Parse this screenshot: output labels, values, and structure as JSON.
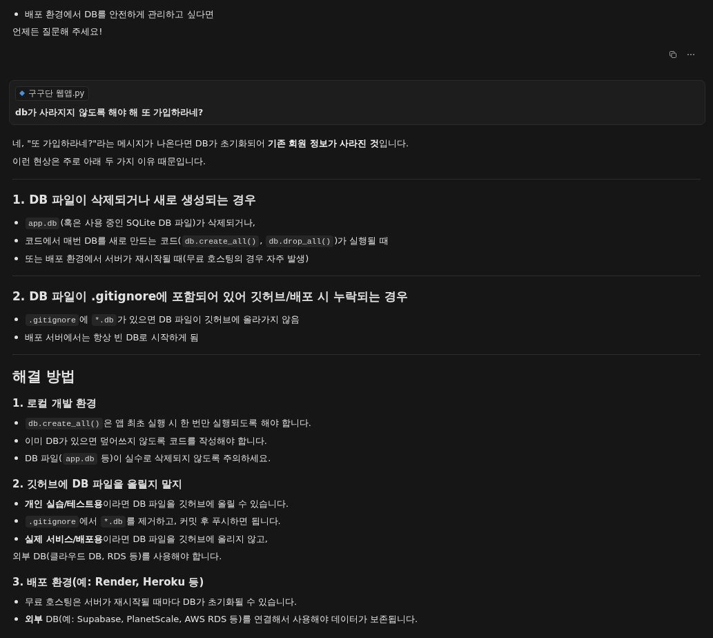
{
  "previous_answer": {
    "blocks": [
      {
        "kind": "bullet",
        "parts": [
          {
            "kind": "text",
            "text": "배포 환경에서 DB를 안전하게 관리하고 싶다면"
          }
        ]
      },
      {
        "kind": "paragraph",
        "parts": [
          {
            "kind": "text",
            "text": "언제든 질문해 주세요!"
          }
        ]
      }
    ]
  },
  "user_message": {
    "attachment": "구구단 웹앱.py",
    "text": "db가 사라지지 않도록 해야 해 또 가입하라네?"
  },
  "answer": {
    "blocks": [
      {
        "kind": "paragraph",
        "parts": [
          {
            "kind": "text",
            "text": "네, \"또 가입하라네?\"라는 메시지가 나온다면 DB가 초기화되어 **기존 회원 정보가 사라진 것**입니다."
          }
        ]
      },
      {
        "kind": "paragraph",
        "parts": [
          {
            "kind": "text",
            "text": "이런 현상은 주로 아래 두 가지 이유 때문입니다."
          }
        ]
      },
      {
        "kind": "divider"
      },
      {
        "kind": "heading3",
        "parts": [
          {
            "kind": "text",
            "text": "1. DB 파일이 삭제되거나 새로 생성되는 경우"
          }
        ]
      },
      {
        "kind": "bullet",
        "parts": [
          {
            "kind": "code",
            "text": "app.db"
          },
          {
            "kind": "text",
            "text": "(혹은 사용 중인 SQLite DB 파일)가 삭제되거나,"
          }
        ]
      },
      {
        "kind": "bullet",
        "parts": [
          {
            "kind": "text",
            "text": "코드에서 매번 DB를 새로 만드는 코드("
          },
          {
            "kind": "code",
            "text": "db.create_all()"
          },
          {
            "kind": "text",
            "text": ", "
          },
          {
            "kind": "code",
            "text": "db.drop_all()"
          },
          {
            "kind": "text",
            "text": ")가 실행될 때"
          }
        ]
      },
      {
        "kind": "bullet",
        "parts": [
          {
            "kind": "text",
            "text": "또는 배포 환경에서 서버가 재시작될 때(무료 호스팅의 경우 자주 발생)"
          }
        ]
      },
      {
        "kind": "divider"
      },
      {
        "kind": "heading3",
        "parts": [
          {
            "kind": "text",
            "text": "2. DB 파일이 .gitignore에 포함되어 있어 깃허브/배포 시 누락되는 경우"
          }
        ]
      },
      {
        "kind": "bullet",
        "parts": [
          {
            "kind": "code",
            "text": ".gitignore"
          },
          {
            "kind": "text",
            "text": "에 "
          },
          {
            "kind": "code",
            "text": "*.db"
          },
          {
            "kind": "text",
            "text": "가 있으면 DB 파일이 깃허브에 올라가지 않음"
          }
        ]
      },
      {
        "kind": "bullet",
        "parts": [
          {
            "kind": "text",
            "text": "배포 서버에서는 항상 빈 DB로 시작하게 됨"
          }
        ]
      },
      {
        "kind": "divider"
      },
      {
        "kind": "heading2",
        "parts": [
          {
            "kind": "text",
            "text": "해결 방법"
          }
        ]
      },
      {
        "kind": "heading4",
        "parts": [
          {
            "kind": "text",
            "text": "1. 로컬 개발 환경"
          }
        ]
      },
      {
        "kind": "bullet",
        "parts": [
          {
            "kind": "code",
            "text": "db.create_all()"
          },
          {
            "kind": "text",
            "text": "은 앱 최초 실행 시 한 번만 실행되도록 해야 합니다."
          }
        ]
      },
      {
        "kind": "bullet",
        "parts": [
          {
            "kind": "text",
            "text": "이미 DB가 있으면 덮어쓰지 않도록 코드를 작성해야 합니다."
          }
        ]
      },
      {
        "kind": "bullet",
        "parts": [
          {
            "kind": "text",
            "text": "DB 파일("
          },
          {
            "kind": "code",
            "text": "app.db"
          },
          {
            "kind": "text",
            "text": " 등)이 실수로 삭제되지 않도록 주의하세요."
          }
        ]
      },
      {
        "kind": "heading4",
        "parts": [
          {
            "kind": "text",
            "text": "2. 깃허브에 DB 파일을 올릴지 말지"
          }
        ]
      },
      {
        "kind": "bullet",
        "parts": [
          {
            "kind": "text",
            "text": "**개인 실습/테스트용**이라면 DB 파일을 깃허브에 올릴 수 있습니다."
          }
        ]
      },
      {
        "kind": "bullet",
        "parts": [
          {
            "kind": "code",
            "text": ".gitignore"
          },
          {
            "kind": "text",
            "text": "에서 "
          },
          {
            "kind": "code",
            "text": "*.db"
          },
          {
            "kind": "text",
            "text": "를 제거하고, 커밋 후 푸시하면 됩니다."
          }
        ]
      },
      {
        "kind": "bullet",
        "parts": [
          {
            "kind": "text",
            "text": "**실제 서비스/배포용**이라면 DB 파일을 깃허브에 올리지 않고,"
          }
        ]
      },
      {
        "kind": "paragraph",
        "parts": [
          {
            "kind": "text",
            "text": "외부 DB(클라우드 DB, RDS 등)를 사용해야 합니다."
          }
        ]
      },
      {
        "kind": "heading4",
        "parts": [
          {
            "kind": "text",
            "text": "3. 배포 환경(예: Render, Heroku 등)"
          }
        ]
      },
      {
        "kind": "bullet",
        "parts": [
          {
            "kind": "text",
            "text": "무료 호스팅은 서버가 재시작될 때마다 DB가 초기화될 수 있습니다."
          }
        ]
      },
      {
        "kind": "bullet",
        "parts": [
          {
            "kind": "text",
            "text": "**외부** DB(예: Supabase, PlanetScale, AWS RDS 등)를 연결해서 사용해야 데이터가 보존됩니다."
          }
        ]
      }
    ]
  }
}
